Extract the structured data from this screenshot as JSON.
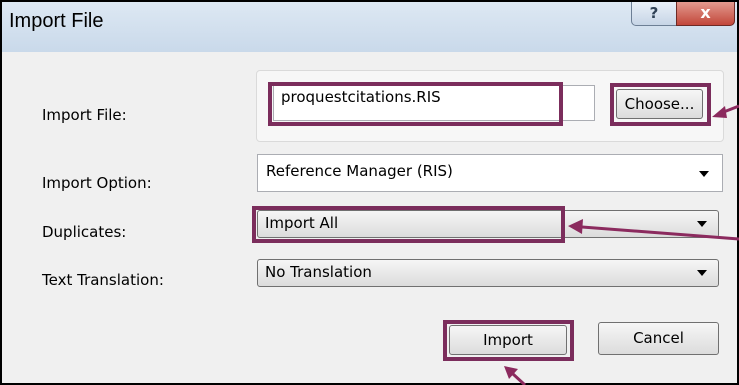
{
  "window": {
    "title": "Import File",
    "help_glyph": "?",
    "close_glyph": "x"
  },
  "form": {
    "import_file": {
      "label": "Import File:",
      "value": "proquestcitations.RIS",
      "choose_label": "Choose..."
    },
    "import_option": {
      "label": "Import Option:",
      "value": "Reference Manager (RIS)"
    },
    "duplicates": {
      "label": "Duplicates:",
      "value": "Import All"
    },
    "text_translation": {
      "label": "Text Translation:",
      "value": "No Translation"
    }
  },
  "buttons": {
    "import": "Import",
    "cancel": "Cancel"
  },
  "colors": {
    "highlight": "#7b2d5c",
    "arrow": "#8b2a5e"
  },
  "icons": [
    "help-icon",
    "close-icon",
    "dropdown-arrow-icon",
    "pointer-arrow"
  ]
}
